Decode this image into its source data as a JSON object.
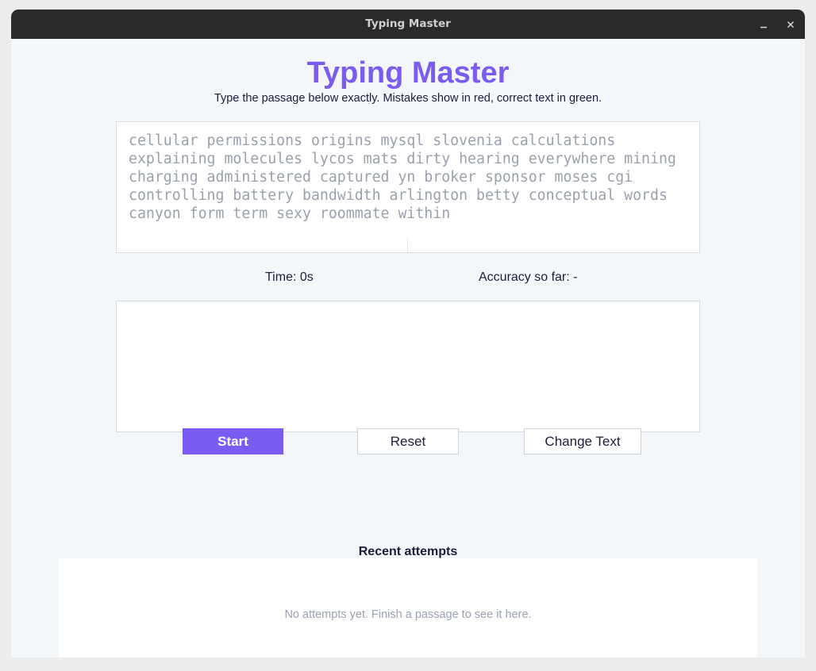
{
  "window": {
    "title": "Typing Master"
  },
  "header": {
    "title": "Typing Master",
    "subtitle": "Type the passage below exactly. Mistakes show in red, correct text in green."
  },
  "passage": {
    "text": "cellular permissions origins mysql slovenia calculations explaining molecules lycos mats dirty hearing everywhere mining charging administered captured yn broker sponsor moses cgi controlling battery bandwidth arlington betty conceptual words canyon form term sexy roommate within"
  },
  "stats": {
    "time": "Time: 0s",
    "accuracy": "Accuracy so far: -"
  },
  "input": {
    "value": ""
  },
  "buttons": {
    "start": "Start",
    "reset": "Reset",
    "change_text": "Change Text"
  },
  "recent": {
    "heading": "Recent attempts",
    "empty_message": "No attempts yet. Finish a passage to see it here."
  },
  "icons": {
    "minimize": "minimize-icon",
    "close": "close-icon"
  },
  "colors": {
    "accent": "#7b5cf3",
    "titlebar": "#2a2a2a",
    "background": "#f4f7fa",
    "text": "#1d1d3b",
    "muted": "#9aa1ad"
  }
}
